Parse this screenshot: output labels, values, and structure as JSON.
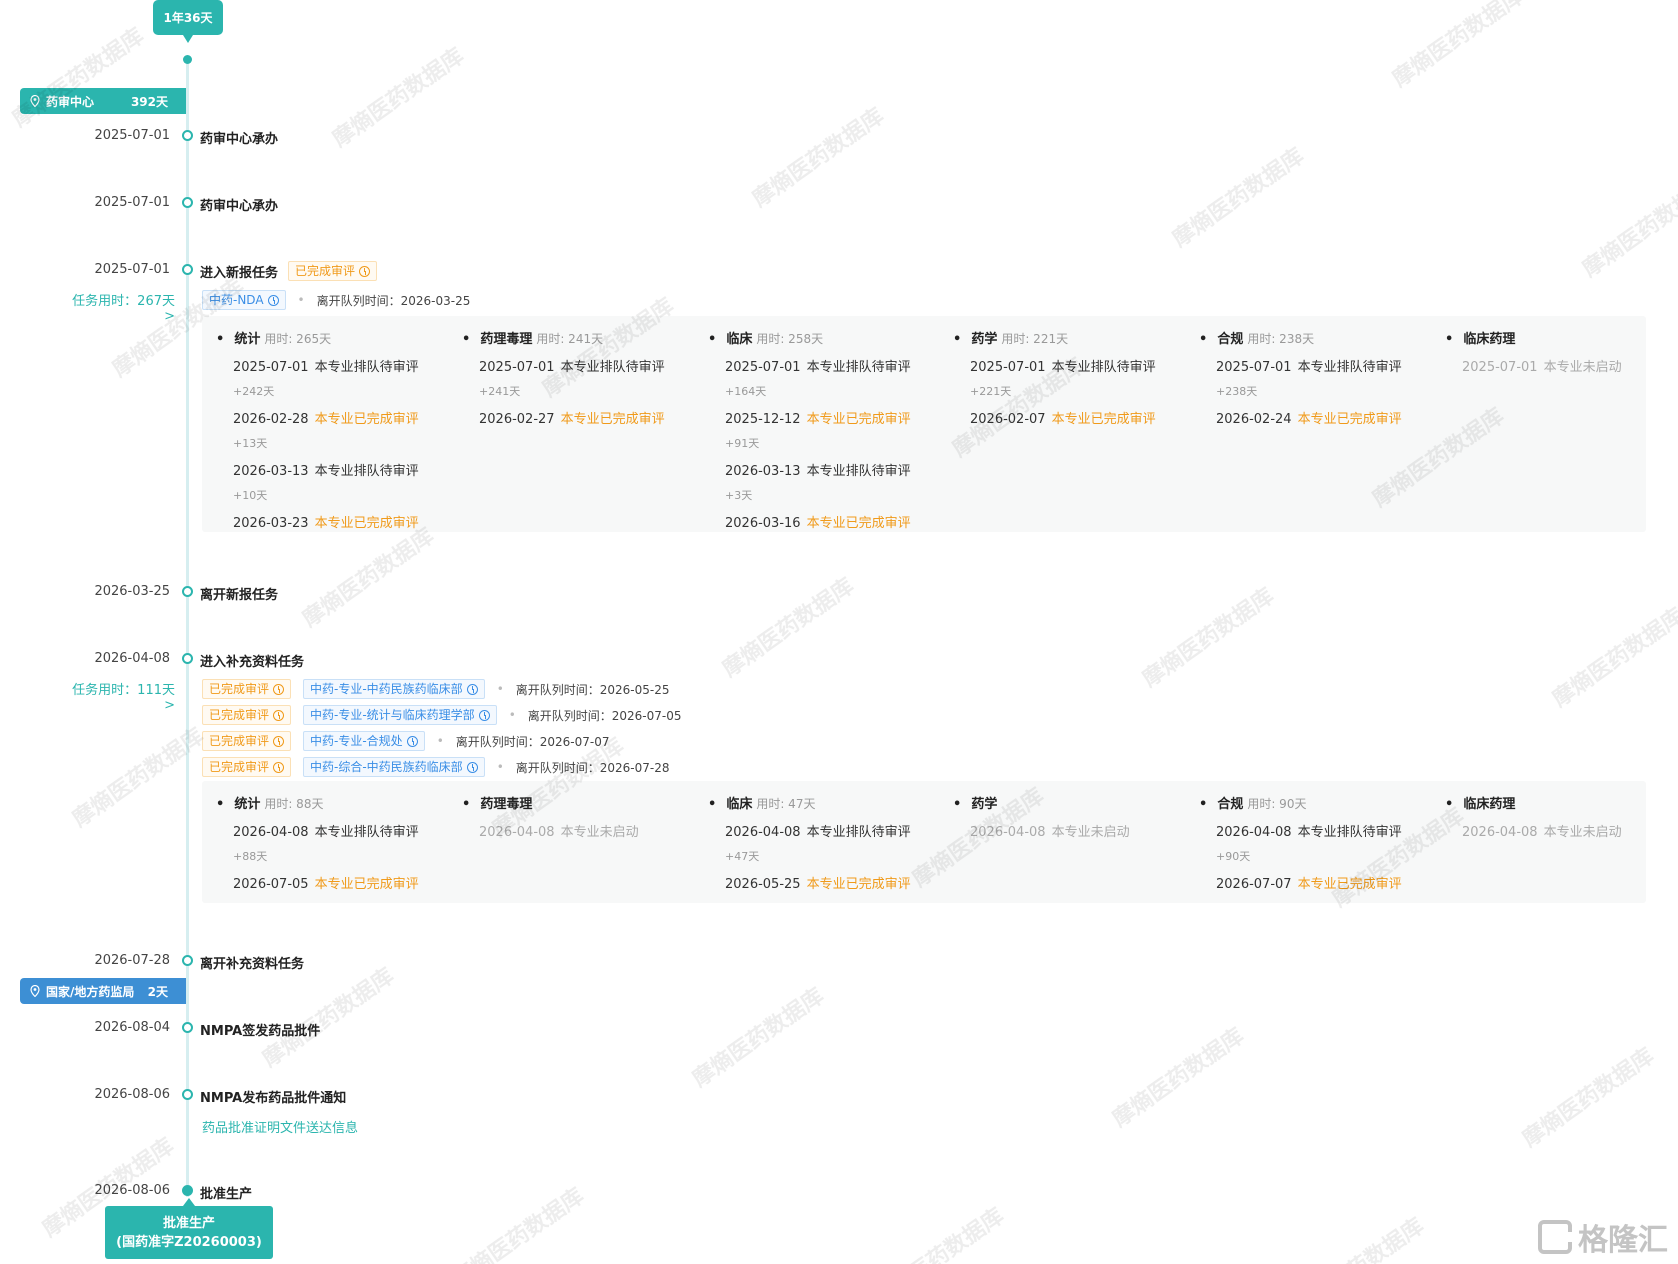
{
  "total_duration": "1年36天",
  "stages": [
    {
      "name": "药审中心",
      "days": "392天",
      "color": "#2bb5ae"
    },
    {
      "name": "国家/地方药监局",
      "days": "2天",
      "color": "#3d8fd4"
    }
  ],
  "events": [
    {
      "date": "2025-07-01",
      "title": "药审中心承办"
    },
    {
      "date": "2025-07-01",
      "title": "药审中心承办"
    },
    {
      "date": "2025-07-01",
      "title": "进入新报任务",
      "status_tag": "已完成审评",
      "task_time": "任务用时：267天 >"
    },
    {
      "date": "2026-03-25",
      "title": "离开新报任务"
    },
    {
      "date": "2026-04-08",
      "title": "进入补充资料任务",
      "task_time": "任务用时：111天 >"
    },
    {
      "date": "2026-07-28",
      "title": "离开补充资料任务"
    },
    {
      "date": "2026-08-04",
      "title": "NMPA签发药品批件"
    },
    {
      "date": "2026-08-06",
      "title": "NMPA发布药品批件通知",
      "link": "药品批准证明文件送达信息"
    },
    {
      "date": "2026-08-06",
      "title": "批准生产"
    }
  ],
  "new_task": {
    "queue_tag": "中药-NDA",
    "leave_label": "离开队列时间：2026-03-25",
    "columns": [
      {
        "name": "统计",
        "used": "用时: 265天",
        "lines": [
          {
            "date": "2025-07-01",
            "status": "本专业排队待审评",
            "type": "normal"
          },
          {
            "gap": "+242天"
          },
          {
            "date": "2026-02-28",
            "status": "本专业已完成审评",
            "type": "done"
          },
          {
            "gap": "+13天"
          },
          {
            "date": "2026-03-13",
            "status": "本专业排队待审评",
            "type": "normal"
          },
          {
            "gap": "+10天"
          },
          {
            "date": "2026-03-23",
            "status": "本专业已完成审评",
            "type": "done"
          }
        ]
      },
      {
        "name": "药理毒理",
        "used": "用时: 241天",
        "lines": [
          {
            "date": "2025-07-01",
            "status": "本专业排队待审评",
            "type": "normal"
          },
          {
            "gap": "+241天"
          },
          {
            "date": "2026-02-27",
            "status": "本专业已完成审评",
            "type": "done"
          }
        ]
      },
      {
        "name": "临床",
        "used": "用时: 258天",
        "lines": [
          {
            "date": "2025-07-01",
            "status": "本专业排队待审评",
            "type": "normal"
          },
          {
            "gap": "+164天"
          },
          {
            "date": "2025-12-12",
            "status": "本专业已完成审评",
            "type": "done"
          },
          {
            "gap": "+91天"
          },
          {
            "date": "2026-03-13",
            "status": "本专业排队待审评",
            "type": "normal"
          },
          {
            "gap": "+3天"
          },
          {
            "date": "2026-03-16",
            "status": "本专业已完成审评",
            "type": "done"
          }
        ]
      },
      {
        "name": "药学",
        "used": "用时: 221天",
        "lines": [
          {
            "date": "2025-07-01",
            "status": "本专业排队待审评",
            "type": "normal"
          },
          {
            "gap": "+221天"
          },
          {
            "date": "2026-02-07",
            "status": "本专业已完成审评",
            "type": "done"
          }
        ]
      },
      {
        "name": "合规",
        "used": "用时: 238天",
        "lines": [
          {
            "date": "2025-07-01",
            "status": "本专业排队待审评",
            "type": "normal"
          },
          {
            "gap": "+238天"
          },
          {
            "date": "2026-02-24",
            "status": "本专业已完成审评",
            "type": "done"
          }
        ]
      },
      {
        "name": "临床药理",
        "used": "",
        "lines": [
          {
            "date": "2025-07-01",
            "status": "本专业未启动",
            "type": "off"
          }
        ]
      }
    ]
  },
  "supp_task": {
    "queues": [
      {
        "status": "已完成审评",
        "dept": "中药-专业-中药民族药临床部",
        "leave": "离开队列时间：2026-05-25"
      },
      {
        "status": "已完成审评",
        "dept": "中药-专业-统计与临床药理学部",
        "leave": "离开队列时间：2026-07-05"
      },
      {
        "status": "已完成审评",
        "dept": "中药-专业-合规处",
        "leave": "离开队列时间：2026-07-07"
      },
      {
        "status": "已完成审评",
        "dept": "中药-综合-中药民族药临床部",
        "leave": "离开队列时间：2026-07-28"
      }
    ],
    "columns": [
      {
        "name": "统计",
        "used": "用时: 88天",
        "lines": [
          {
            "date": "2026-04-08",
            "status": "本专业排队待审评",
            "type": "normal"
          },
          {
            "gap": "+88天"
          },
          {
            "date": "2026-07-05",
            "status": "本专业已完成审评",
            "type": "done"
          }
        ]
      },
      {
        "name": "药理毒理",
        "used": "",
        "lines": [
          {
            "date": "2026-04-08",
            "status": "本专业未启动",
            "type": "off"
          }
        ]
      },
      {
        "name": "临床",
        "used": "用时: 47天",
        "lines": [
          {
            "date": "2026-04-08",
            "status": "本专业排队待审评",
            "type": "normal"
          },
          {
            "gap": "+47天"
          },
          {
            "date": "2026-05-25",
            "status": "本专业已完成审评",
            "type": "done"
          }
        ]
      },
      {
        "name": "药学",
        "used": "",
        "lines": [
          {
            "date": "2026-04-08",
            "status": "本专业未启动",
            "type": "off"
          }
        ]
      },
      {
        "name": "合规",
        "used": "用时: 90天",
        "lines": [
          {
            "date": "2026-04-08",
            "status": "本专业排队待审评",
            "type": "normal"
          },
          {
            "gap": "+90天"
          },
          {
            "date": "2026-07-07",
            "status": "本专业已完成审评",
            "type": "done"
          }
        ]
      },
      {
        "name": "临床药理",
        "used": "",
        "lines": [
          {
            "date": "2026-04-08",
            "status": "本专业未启动",
            "type": "off"
          }
        ]
      }
    ]
  },
  "approval": {
    "line1": "批准生产",
    "line2": "(国药准字Z20260003)"
  },
  "watermark_text": "摩熵医药数据库",
  "logo_text": "格隆汇",
  "colors": {
    "teal": "#2bb5ae",
    "blue": "#3d8fd4",
    "orange": "#f09a1a"
  }
}
